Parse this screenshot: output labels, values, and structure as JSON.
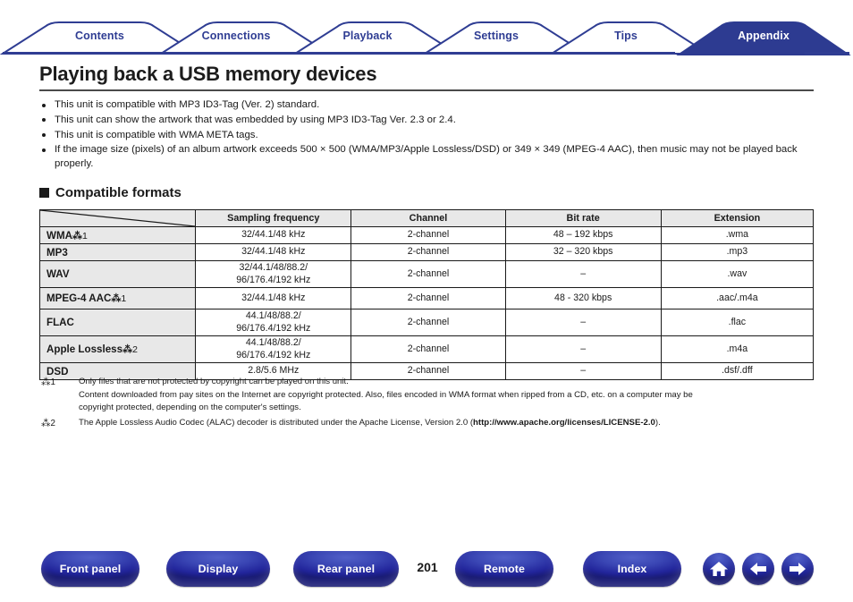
{
  "tabs": [
    {
      "label": "Contents",
      "active": false
    },
    {
      "label": "Connections",
      "active": false
    },
    {
      "label": "Playback",
      "active": false
    },
    {
      "label": "Settings",
      "active": false
    },
    {
      "label": "Tips",
      "active": false
    },
    {
      "label": "Appendix",
      "active": true
    }
  ],
  "page_title": "Playing back a USB memory devices",
  "bullets": [
    "This unit is compatible with MP3 ID3-Tag (Ver. 2) standard.",
    "This unit can show the artwork that was embedded by using MP3 ID3-Tag Ver. 2.3 or 2.4.",
    "This unit is compatible with WMA META tags.",
    "If the image size (pixels) of an album artwork exceeds 500 × 500 (WMA/MP3/Apple Lossless/DSD) or 349 × 349 (MPEG-4 AAC), then music may not be played back properly."
  ],
  "section": {
    "heading": "Compatible formats"
  },
  "table": {
    "corner_label": "",
    "headers": [
      "Sampling frequency",
      "Channel",
      "Bit rate",
      "Extension"
    ],
    "rows": [
      {
        "format": "WMA",
        "footnote": "1",
        "sampling": "32/44.1/48 kHz",
        "channel": "2-channel",
        "bitrate": "48 – 192 kbps",
        "extension": ".wma"
      },
      {
        "format": "MP3",
        "footnote": "",
        "sampling": "32/44.1/48 kHz",
        "channel": "2-channel",
        "bitrate": "32 – 320 kbps",
        "extension": ".mp3"
      },
      {
        "format": "WAV",
        "footnote": "",
        "sampling": "32/44.1/48/88.2/\n96/176.4/192 kHz",
        "channel": "2-channel",
        "bitrate": "–",
        "extension": ".wav"
      },
      {
        "format": "MPEG-4 AAC",
        "footnote": "1",
        "sampling": "32/44.1/48 kHz",
        "channel": "2-channel",
        "bitrate": "48 - 320 kbps",
        "extension": ".aac/.m4a"
      },
      {
        "format": "FLAC",
        "footnote": "",
        "sampling": "44.1/48/88.2/\n96/176.4/192 kHz",
        "channel": "2-channel",
        "bitrate": "–",
        "extension": ".flac"
      },
      {
        "format": "Apple Lossless",
        "footnote": "2",
        "sampling": "44.1/48/88.2/\n96/176.4/192 kHz",
        "channel": "2-channel",
        "bitrate": "–",
        "extension": ".m4a"
      },
      {
        "format": "DSD",
        "footnote": "",
        "sampling": "2.8/5.6 MHz",
        "channel": "2-channel",
        "bitrate": "–",
        "extension": ".dsf/.dff"
      }
    ]
  },
  "footnotes": [
    {
      "marker": "1",
      "lines": [
        "Only files that are not protected by copyright can be played on this unit.",
        "Content downloaded from pay sites on the Internet are copyright protected. Also, files encoded in WMA format when ripped from a CD, etc. on a computer may be",
        "copyright protected, depending on the computer's settings."
      ],
      "bold_tail": ""
    },
    {
      "marker": "2",
      "lines": [
        "The Apple Lossless Audio Codec (ALAC) decoder is distributed under the Apache License, Version 2.0 ("
      ],
      "bold_tail": "http://www.apache.org/licenses/LICENSE-2.0",
      "tail": ")."
    }
  ],
  "bottom_nav": {
    "buttons": [
      {
        "label": "Front panel"
      },
      {
        "label": "Display"
      },
      {
        "label": "Rear panel"
      },
      {
        "label": "Remote"
      },
      {
        "label": "Index"
      }
    ],
    "page_number": "201",
    "icons": [
      {
        "name": "home-icon"
      },
      {
        "name": "arrow-left-icon"
      },
      {
        "name": "arrow-right-icon"
      }
    ]
  },
  "colors": {
    "tab_blue": "#2f3d93",
    "tab_active_bg": "#2d3b91",
    "header_row_bg": "#e8e8e8",
    "button_blue": "#2a34a8"
  }
}
